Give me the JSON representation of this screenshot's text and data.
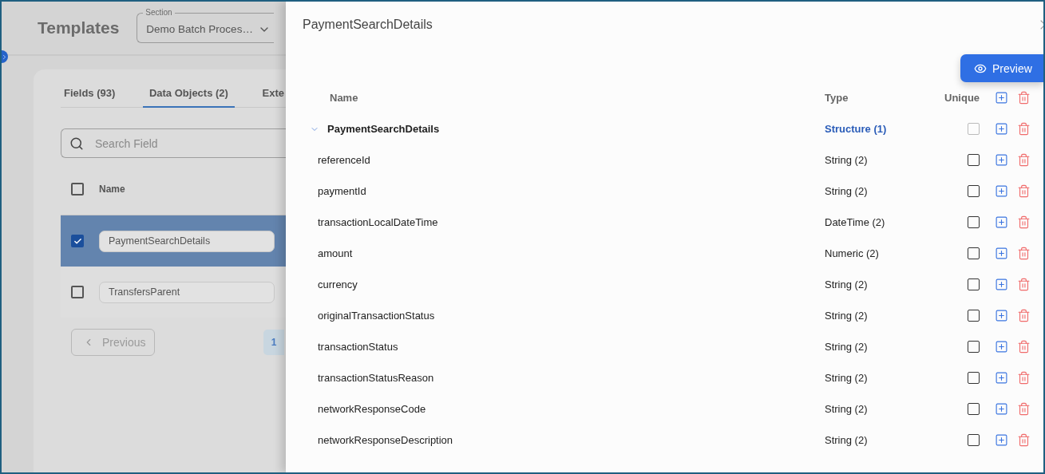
{
  "header": {
    "title": "Templates",
    "section": {
      "label": "Section",
      "value": "Demo Batch Proces…"
    }
  },
  "tabs": [
    {
      "label": "Fields (93)",
      "selected": false
    },
    {
      "label": "Data Objects (2)",
      "selected": true
    },
    {
      "label": "Exte",
      "selected": false
    }
  ],
  "search": {
    "placeholder": "Search Field"
  },
  "list": {
    "column": "Name",
    "all_checked": false,
    "rows": [
      {
        "name": "PaymentSearchDetails",
        "checked": true,
        "selected": true
      },
      {
        "name": "TransfersParent",
        "checked": false,
        "selected": false
      }
    ]
  },
  "pagination": {
    "previous": "Previous",
    "pages": [
      {
        "label": "1",
        "selected": true
      }
    ]
  },
  "drawer": {
    "title": "PaymentSearchDetails",
    "preview": "Preview",
    "columns": {
      "name": "Name",
      "type": "Type",
      "unique": "Unique"
    },
    "tree": [
      {
        "name": "PaymentSearchDetails",
        "type": "Structure (1)",
        "kind": "structure",
        "expanded": true,
        "checked": false,
        "disabled": true,
        "children": [
          {
            "name": "referenceId",
            "type": "String (2)",
            "kind": "field",
            "checked": false,
            "disabled": false
          },
          {
            "name": "paymentId",
            "type": "String (2)",
            "kind": "field",
            "checked": false,
            "disabled": false
          },
          {
            "name": "transactionLocalDateTime",
            "type": "DateTime (2)",
            "kind": "field",
            "checked": false,
            "disabled": false
          },
          {
            "name": "amount",
            "type": "Numeric (2)",
            "kind": "field",
            "checked": false,
            "disabled": false
          },
          {
            "name": "currency",
            "type": "String (2)",
            "kind": "field",
            "checked": false,
            "disabled": false
          },
          {
            "name": "originalTransactionStatus",
            "type": "String (2)",
            "kind": "field",
            "checked": false,
            "disabled": false
          },
          {
            "name": "transactionStatus",
            "type": "String (2)",
            "kind": "field",
            "checked": false,
            "disabled": false
          },
          {
            "name": "transactionStatusReason",
            "type": "String (2)",
            "kind": "field",
            "checked": false,
            "disabled": false
          },
          {
            "name": "networkResponseCode",
            "type": "String (2)",
            "kind": "field",
            "checked": false,
            "disabled": false
          },
          {
            "name": "networkResponseDescription",
            "type": "String (2)",
            "kind": "field",
            "checked": false,
            "disabled": false
          }
        ]
      }
    ]
  }
}
